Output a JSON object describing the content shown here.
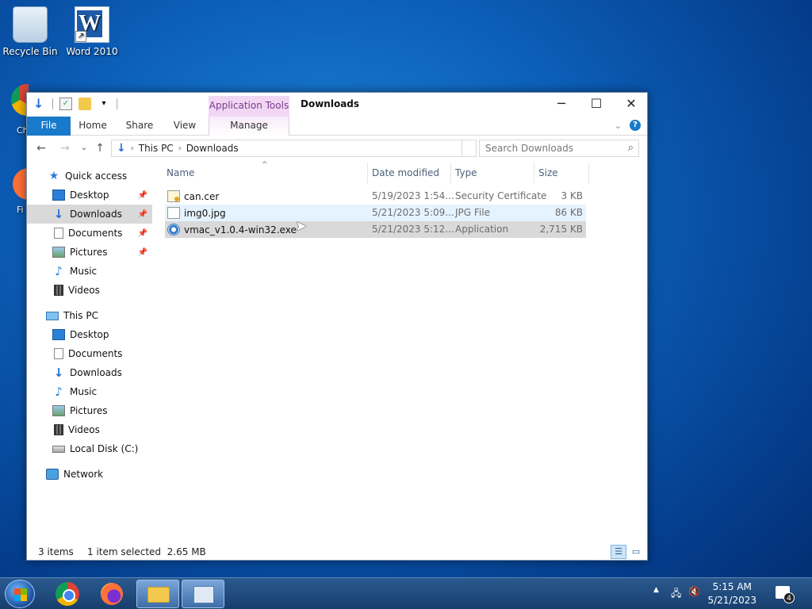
{
  "desktop": {
    "icons": [
      {
        "label": "Recycle Bin",
        "icon": "recycle-bin-icon"
      },
      {
        "label": "Word 2010",
        "icon": "word-icon"
      }
    ],
    "partial_labels": [
      "Ch",
      "Fi"
    ]
  },
  "window": {
    "title": "Downloads",
    "qat_icons": [
      "down-arrow-icon",
      "properties-icon",
      "new-folder-icon",
      "customize-caret-icon"
    ],
    "context_group": "Application Tools",
    "ribbon_tabs": [
      "File",
      "Home",
      "Share",
      "View"
    ],
    "context_tab": "Manage",
    "controls": {
      "minimize": "─",
      "maximize": "☐",
      "close": "✕"
    }
  },
  "address": {
    "crumbs": [
      "This PC",
      "Downloads"
    ],
    "search_placeholder": "Search Downloads"
  },
  "nav_pane": {
    "quick_access": {
      "label": "Quick access",
      "items": [
        {
          "label": "Desktop",
          "icon": "desktop-icon",
          "pinned": true
        },
        {
          "label": "Downloads",
          "icon": "downloads-icon",
          "pinned": true,
          "selected": true
        },
        {
          "label": "Documents",
          "icon": "documents-icon",
          "pinned": true
        },
        {
          "label": "Pictures",
          "icon": "pictures-icon",
          "pinned": true
        },
        {
          "label": "Music",
          "icon": "music-icon",
          "pinned": false
        },
        {
          "label": "Videos",
          "icon": "videos-icon",
          "pinned": false
        }
      ]
    },
    "this_pc": {
      "label": "This PC",
      "items": [
        {
          "label": "Desktop",
          "icon": "desktop-icon"
        },
        {
          "label": "Documents",
          "icon": "documents-icon"
        },
        {
          "label": "Downloads",
          "icon": "downloads-icon"
        },
        {
          "label": "Music",
          "icon": "music-icon"
        },
        {
          "label": "Pictures",
          "icon": "pictures-icon"
        },
        {
          "label": "Videos",
          "icon": "videos-icon"
        },
        {
          "label": "Local Disk (C:)",
          "icon": "drive-icon"
        }
      ]
    },
    "network": {
      "label": "Network"
    }
  },
  "files": {
    "columns": [
      "Name",
      "Date modified",
      "Type",
      "Size"
    ],
    "rows": [
      {
        "name": "can.cer",
        "date": "5/19/2023 1:54...",
        "type": "Security Certificate",
        "size": "3 KB",
        "icon": "certificate-file-icon",
        "state": "normal"
      },
      {
        "name": "img0.jpg",
        "date": "5/21/2023 5:09...",
        "type": "JPG File",
        "size": "86 KB",
        "icon": "image-file-icon",
        "state": "hover"
      },
      {
        "name": "vmac_v1.0.4-win32.exe",
        "date": "5/21/2023 5:12...",
        "type": "Application",
        "size": "2,715 KB",
        "icon": "application-file-icon",
        "state": "selected"
      }
    ]
  },
  "status": {
    "items_count": "3 items",
    "selection": "1 item selected  2.65 MB"
  },
  "taskbar": {
    "apps": [
      "start-button",
      "chrome-icon",
      "firefox-icon",
      "file-explorer-icon",
      "control-panel-icon"
    ],
    "clock_time": "5:15 AM",
    "clock_date": "5/21/2023",
    "notification_count": "4"
  }
}
